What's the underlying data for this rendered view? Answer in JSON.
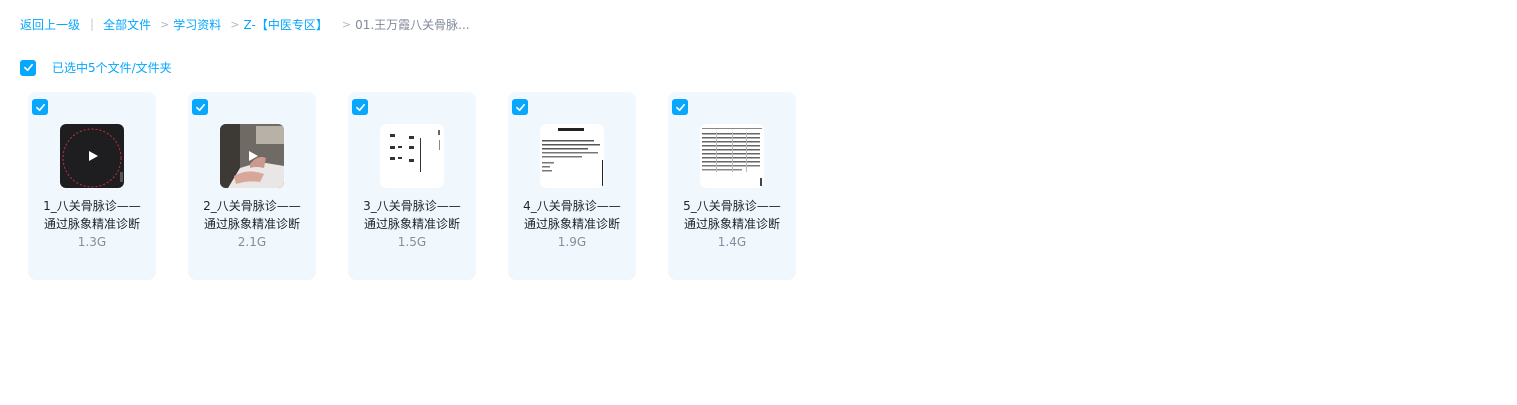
{
  "breadcrumb": {
    "back": "返回上一级",
    "items": [
      "全部文件",
      "学习资料",
      "Z-【中医专区】"
    ],
    "current": "01.王万霞八关骨脉...",
    "separator": ">",
    "divider": "|"
  },
  "selection": {
    "label": "已选中5个文件/文件夹",
    "checked": true
  },
  "files": [
    {
      "name_line1": "1_八关骨脉诊——",
      "name_line2": "通过脉象精准诊断",
      "size": "1.3G",
      "thumb": "video-dark-icon",
      "checked": true
    },
    {
      "name_line1": "2_八关骨脉诊——",
      "name_line2": "通过脉象精准诊断",
      "size": "2.1G",
      "thumb": "video-photo-icon",
      "checked": true
    },
    {
      "name_line1": "3_八关骨脉诊——",
      "name_line2": "通过脉象精准诊断",
      "size": "1.5G",
      "thumb": "document-page-icon",
      "checked": true
    },
    {
      "name_line1": "4_八关骨脉诊——",
      "name_line2": "通过脉象精准诊断",
      "size": "1.9G",
      "thumb": "document-page-icon",
      "checked": true
    },
    {
      "name_line1": "5_八关骨脉诊——",
      "name_line2": "通过脉象精准诊断",
      "size": "1.4G",
      "thumb": "table-page-icon",
      "checked": true
    }
  ],
  "colors": {
    "accent": "#06a7ff",
    "card_bg": "#f1f8fd",
    "muted": "#878c9c"
  }
}
